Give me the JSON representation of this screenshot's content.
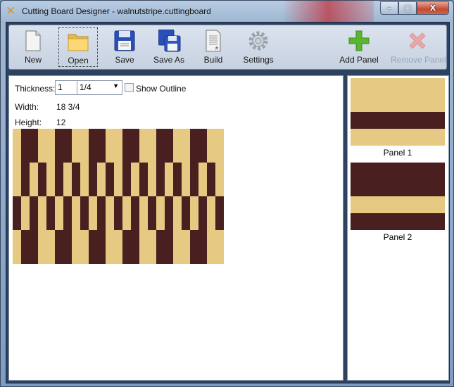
{
  "window": {
    "title": "Cutting Board Designer - walnutstripe.cuttingboard",
    "minimize": "–",
    "maximize": "□",
    "close": "X"
  },
  "toolbar": {
    "items": [
      {
        "label": "New",
        "icon": "new-document-icon"
      },
      {
        "label": "Open",
        "icon": "folder-icon"
      },
      {
        "label": "Save",
        "icon": "floppy-icon"
      },
      {
        "label": "Save As",
        "icon": "floppy-double-icon"
      },
      {
        "label": "Build",
        "icon": "document-list-icon"
      },
      {
        "label": "Settings",
        "icon": "gear-icon"
      },
      {
        "label": "Add Panel",
        "icon": "plus-icon"
      },
      {
        "label": "Remove Panel",
        "icon": "x-icon",
        "disabled": true
      }
    ]
  },
  "properties": {
    "thickness_label": "Thickness:",
    "thickness_whole": "1",
    "thickness_fraction": "1/4",
    "show_outline_label": "Show Outline",
    "show_outline": false,
    "width_label": "Width:",
    "width_value": "18 3/4",
    "height_label": "Height:",
    "height_value": "12"
  },
  "colors": {
    "maple": "#e6ca84",
    "walnut": "#4a1f1f"
  },
  "board": {
    "rows": [
      "MWWMMWWMMWWMMWWMMWWMMWWMM",
      "MWMWMWMWMWMWMWMWMWMWMWMWM",
      "WMWMWMWMWMWMWMWMWMWMWMWMW",
      "MWWMMWWMMWWMMWWMMWWMMWWMM"
    ]
  },
  "panels": [
    {
      "label": "Panel 1",
      "strips": [
        {
          "wood": "M",
          "size": 2
        },
        {
          "wood": "W",
          "size": 1
        },
        {
          "wood": "M",
          "size": 1
        }
      ]
    },
    {
      "label": "Panel 2",
      "strips": [
        {
          "wood": "W",
          "size": 2
        },
        {
          "wood": "M",
          "size": 1
        },
        {
          "wood": "W",
          "size": 1
        }
      ]
    }
  ]
}
